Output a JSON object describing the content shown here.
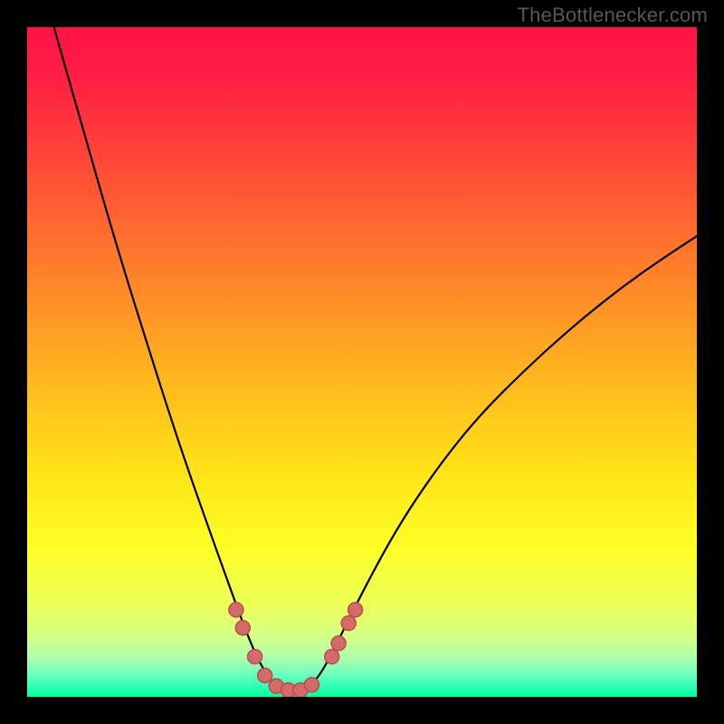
{
  "watermark": "TheBottlenecker.com",
  "chart_data": {
    "type": "line",
    "title": "",
    "xlabel": "",
    "ylabel": "",
    "xlim": [
      0,
      100
    ],
    "ylim": [
      0,
      100
    ],
    "background_gradient": {
      "stops": [
        {
          "offset": 0.0,
          "color": "#ff1346"
        },
        {
          "offset": 0.07,
          "color": "#ff1d44"
        },
        {
          "offset": 0.18,
          "color": "#ff4139"
        },
        {
          "offset": 0.3,
          "color": "#ff6a2f"
        },
        {
          "offset": 0.42,
          "color": "#ff9326"
        },
        {
          "offset": 0.55,
          "color": "#ffbf1d"
        },
        {
          "offset": 0.67,
          "color": "#ffe518"
        },
        {
          "offset": 0.78,
          "color": "#fdff27"
        },
        {
          "offset": 0.86,
          "color": "#ecff56"
        },
        {
          "offset": 0.905,
          "color": "#d8ff82"
        },
        {
          "offset": 0.94,
          "color": "#b0ffa8"
        },
        {
          "offset": 0.965,
          "color": "#70ffbf"
        },
        {
          "offset": 0.985,
          "color": "#2cffb5"
        },
        {
          "offset": 1.0,
          "color": "#00ff96"
        }
      ]
    },
    "series": [
      {
        "name": "bottleneck-curve",
        "color": "#000000",
        "width": 2.2,
        "points": [
          {
            "x": 4.0,
            "y": 100.0
          },
          {
            "x": 6.0,
            "y": 93.0
          },
          {
            "x": 9.0,
            "y": 82.5
          },
          {
            "x": 12.0,
            "y": 72.0
          },
          {
            "x": 15.0,
            "y": 62.0
          },
          {
            "x": 18.0,
            "y": 52.5
          },
          {
            "x": 21.0,
            "y": 43.0
          },
          {
            "x": 24.0,
            "y": 34.0
          },
          {
            "x": 27.0,
            "y": 25.5
          },
          {
            "x": 29.5,
            "y": 18.5
          },
          {
            "x": 31.5,
            "y": 13.0
          },
          {
            "x": 33.0,
            "y": 9.0
          },
          {
            "x": 34.5,
            "y": 5.5
          },
          {
            "x": 36.0,
            "y": 3.0
          },
          {
            "x": 37.5,
            "y": 1.4
          },
          {
            "x": 39.0,
            "y": 0.8
          },
          {
            "x": 40.5,
            "y": 0.8
          },
          {
            "x": 42.0,
            "y": 1.4
          },
          {
            "x": 43.5,
            "y": 3.0
          },
          {
            "x": 45.0,
            "y": 5.5
          },
          {
            "x": 47.0,
            "y": 9.5
          },
          {
            "x": 50.0,
            "y": 15.5
          },
          {
            "x": 54.0,
            "y": 23.0
          },
          {
            "x": 58.0,
            "y": 29.5
          },
          {
            "x": 63.0,
            "y": 36.5
          },
          {
            "x": 68.0,
            "y": 42.5
          },
          {
            "x": 74.0,
            "y": 48.5
          },
          {
            "x": 80.0,
            "y": 54.0
          },
          {
            "x": 86.0,
            "y": 59.0
          },
          {
            "x": 92.0,
            "y": 63.5
          },
          {
            "x": 98.0,
            "y": 67.5
          },
          {
            "x": 100.0,
            "y": 68.8
          }
        ]
      }
    ],
    "markers": {
      "color": "#d46a6a",
      "stroke": "#b94c4c",
      "radius": 8,
      "points": [
        {
          "x": 31.2,
          "y": 13.0
        },
        {
          "x": 32.2,
          "y": 10.3
        },
        {
          "x": 34.0,
          "y": 6.0
        },
        {
          "x": 35.5,
          "y": 3.2
        },
        {
          "x": 37.2,
          "y": 1.6
        },
        {
          "x": 39.0,
          "y": 1.0
        },
        {
          "x": 40.8,
          "y": 1.0
        },
        {
          "x": 42.5,
          "y": 1.8
        },
        {
          "x": 45.5,
          "y": 6.0
        },
        {
          "x": 46.5,
          "y": 8.0
        },
        {
          "x": 48.0,
          "y": 11.0
        },
        {
          "x": 49.0,
          "y": 13.0
        }
      ]
    }
  }
}
